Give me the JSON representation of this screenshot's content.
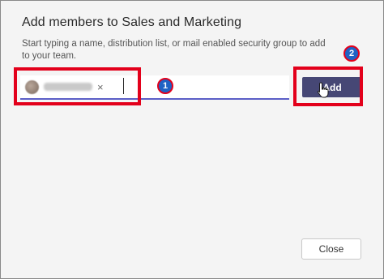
{
  "dialog": {
    "title": "Add members to Sales and Marketing",
    "description": "Start typing a name, distribution list, or mail enabled security group to add to your team."
  },
  "member_input": {
    "chip_remove_symbol": "×"
  },
  "buttons": {
    "add_label": "Add",
    "close_label": "Close"
  },
  "annotations": {
    "step_1": "1",
    "step_2": "2"
  },
  "colors": {
    "accent": "#5b5fc7",
    "add_button": "#464775",
    "highlight": "#e3001b",
    "badge": "#2062c4"
  },
  "icons": {
    "pointer": "hand-pointer-icon"
  }
}
